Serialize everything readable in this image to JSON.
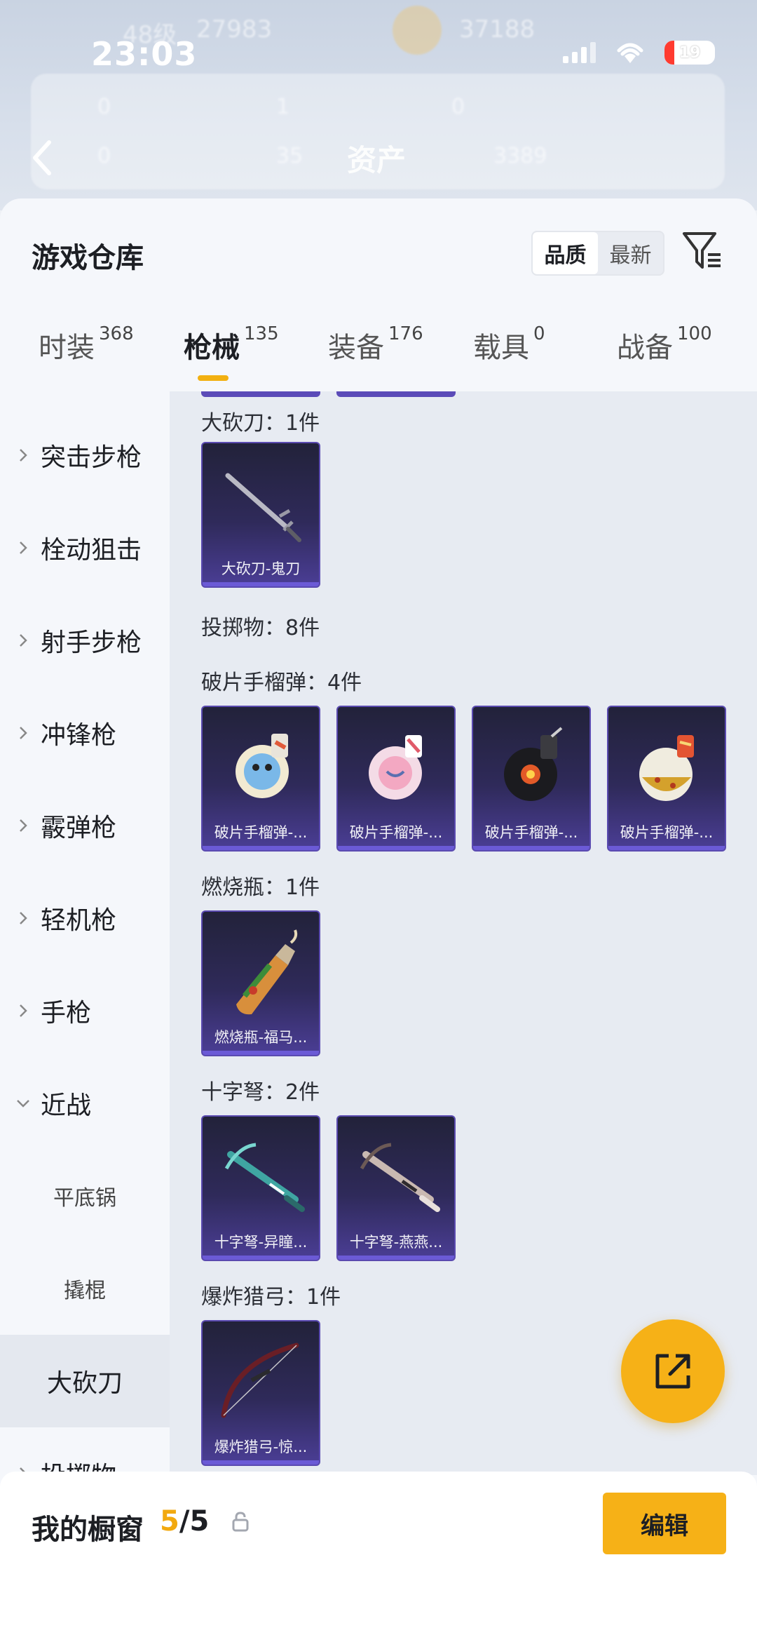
{
  "status_bar": {
    "time": "23:03",
    "battery": "19"
  },
  "header": {
    "title": "资产",
    "ghost_level": "48级",
    "ghost_coin1": "27983",
    "ghost_coin2": "37188",
    "ghost_stats": [
      "0",
      "1",
      "0",
      "0",
      "35",
      "3389"
    ]
  },
  "sheet": {
    "title": "游戏仓库",
    "sort_options": [
      "品质",
      "最新"
    ],
    "tabs": [
      {
        "label": "时装",
        "count": "368"
      },
      {
        "label": "枪械",
        "count": "135"
      },
      {
        "label": "装备",
        "count": "176"
      },
      {
        "label": "载具",
        "count": "0"
      },
      {
        "label": "战备",
        "count": "100"
      }
    ],
    "active_tab": "枪械"
  },
  "sidebar": {
    "items": [
      {
        "label": "突击步枪",
        "state": "collapsed"
      },
      {
        "label": "栓动狙击",
        "state": "collapsed"
      },
      {
        "label": "射手步枪",
        "state": "collapsed"
      },
      {
        "label": "冲锋枪",
        "state": "collapsed"
      },
      {
        "label": "霰弹枪",
        "state": "collapsed"
      },
      {
        "label": "轻机枪",
        "state": "collapsed"
      },
      {
        "label": "手枪",
        "state": "collapsed"
      },
      {
        "label": "近战",
        "state": "expanded"
      },
      {
        "label": "平底锅",
        "state": "sub"
      },
      {
        "label": "撬棍",
        "state": "sub"
      },
      {
        "label": "大砍刀",
        "state": "selected"
      },
      {
        "label": "投掷物",
        "state": "collapsed"
      }
    ]
  },
  "content": {
    "sections": [
      {
        "title": "大砍刀：1件",
        "items": [
          "大砍刀-鬼刀"
        ]
      },
      {
        "title": "投掷物：8件",
        "items": []
      },
      {
        "title": "破片手榴弹：4件",
        "items": [
          "破片手榴弹-...",
          "破片手榴弹-...",
          "破片手榴弹-...",
          "破片手榴弹-..."
        ]
      },
      {
        "title": "燃烧瓶：1件",
        "items": [
          "燃烧瓶-福马..."
        ]
      },
      {
        "title": "十字弩：2件",
        "items": [
          "十字弩-异瞳...",
          "十字弩-燕燕..."
        ]
      },
      {
        "title": "爆炸猎弓：1件",
        "items": [
          "爆炸猎弓-惊..."
        ]
      }
    ]
  },
  "showcase": {
    "title": "我的橱窗",
    "current": "5",
    "total": "/5",
    "edit_label": "编辑"
  },
  "icons": {
    "back": "back-arrow-icon",
    "filter": "filter-icon",
    "share": "share-external-icon",
    "lock": "lock-icon",
    "chevron": "chevron-right-icon"
  },
  "colors": {
    "accent": "#f6b117",
    "card_gradient_bottom": "#4b3e96"
  }
}
